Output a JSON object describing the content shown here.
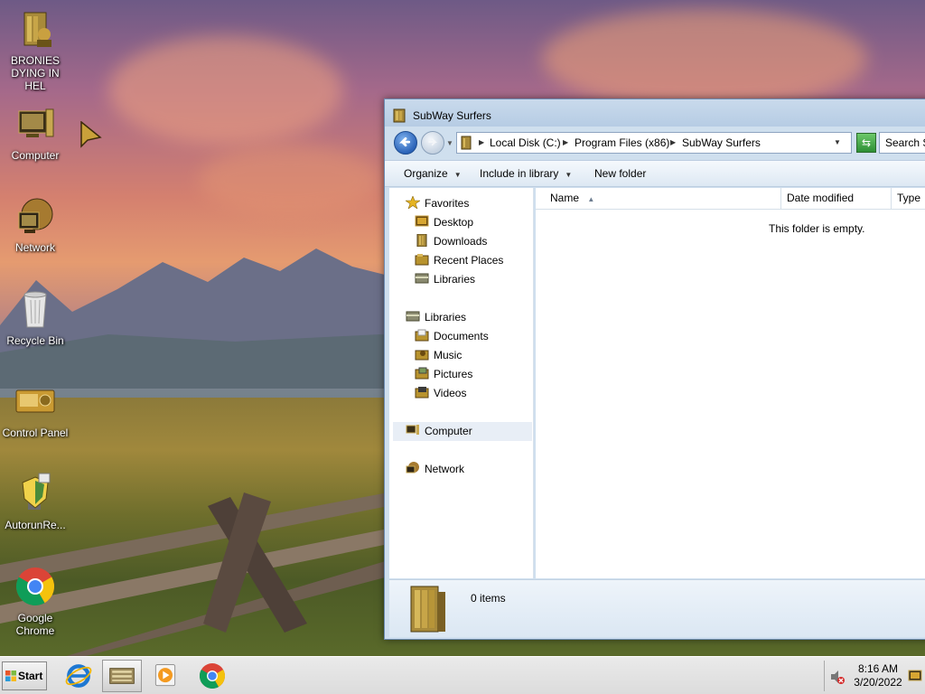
{
  "desktop": {
    "icons": [
      {
        "label": "BRONIES DYING IN HEL",
        "icon": "folder-icon"
      },
      {
        "label": "Computer",
        "icon": "computer-icon"
      },
      {
        "label": "Network",
        "icon": "network-icon"
      },
      {
        "label": "Recycle Bin",
        "icon": "recycle-bin-icon"
      },
      {
        "label": "Control Panel",
        "icon": "control-panel-icon"
      },
      {
        "label": "AutorunRe...",
        "icon": "shield-icon"
      },
      {
        "label": "Google Chrome",
        "icon": "chrome-icon"
      }
    ]
  },
  "explorer": {
    "title": "SubWay Surfers",
    "address": {
      "crumbs": [
        "Local Disk (C:)",
        "Program Files (x86)",
        "SubWay Surfers"
      ]
    },
    "search_placeholder": "Search S",
    "commands": {
      "organize": "Organize",
      "include_in_library": "Include in library",
      "new_folder": "New folder"
    },
    "nav": {
      "favorites": "Favorites",
      "desktop": "Desktop",
      "downloads": "Downloads",
      "recent_places": "Recent Places",
      "libraries_fav": "Libraries",
      "libraries": "Libraries",
      "documents": "Documents",
      "music": "Music",
      "pictures": "Pictures",
      "videos": "Videos",
      "computer": "Computer",
      "network": "Network"
    },
    "columns": {
      "name": "Name",
      "date_modified": "Date modified",
      "type": "Type"
    },
    "empty_message": "This folder is empty.",
    "item_count": "0 items"
  },
  "taskbar": {
    "start_label": "Start",
    "pinned": [
      "internet-explorer-icon",
      "explorer-icon",
      "media-player-icon",
      "chrome-icon"
    ],
    "clock": {
      "time": "8:16 AM",
      "date": "3/20/2022"
    }
  },
  "colors": {
    "window_frame": "#cfdfee",
    "accent_blue": "#2b63b8",
    "icon_gold": "#b8932e"
  }
}
